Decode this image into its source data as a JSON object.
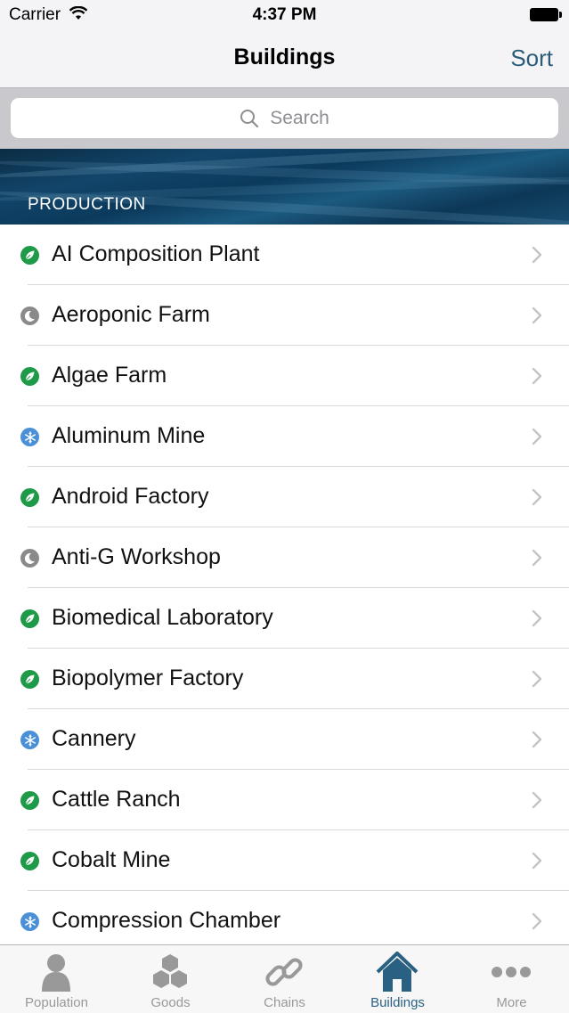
{
  "status_bar": {
    "carrier": "Carrier",
    "time": "4:37 PM"
  },
  "nav": {
    "title": "Buildings",
    "sort_label": "Sort"
  },
  "search": {
    "placeholder": "Search"
  },
  "section": {
    "title": "PRODUCTION"
  },
  "rows": [
    {
      "label": "AI Composition Plant",
      "icon": "leaf-icon",
      "color": "#1e9a48"
    },
    {
      "label": "Aeroponic Farm",
      "icon": "moon-icon",
      "color": "#8a8a8a"
    },
    {
      "label": "Algae Farm",
      "icon": "leaf-icon",
      "color": "#1e9a48"
    },
    {
      "label": "Aluminum Mine",
      "icon": "snowflake-icon",
      "color": "#4a90d6"
    },
    {
      "label": "Android Factory",
      "icon": "leaf-icon",
      "color": "#1e9a48"
    },
    {
      "label": "Anti-G Workshop",
      "icon": "moon-icon",
      "color": "#8a8a8a"
    },
    {
      "label": "Biomedical Laboratory",
      "icon": "leaf-icon",
      "color": "#1e9a48"
    },
    {
      "label": "Biopolymer Factory",
      "icon": "leaf-icon",
      "color": "#1e9a48"
    },
    {
      "label": "Cannery",
      "icon": "snowflake-icon",
      "color": "#4a90d6"
    },
    {
      "label": "Cattle Ranch",
      "icon": "leaf-icon",
      "color": "#1e9a48"
    },
    {
      "label": "Cobalt Mine",
      "icon": "leaf-icon",
      "color": "#1e9a48"
    },
    {
      "label": "Compression Chamber",
      "icon": "snowflake-icon",
      "color": "#4a90d6"
    }
  ],
  "tabs": [
    {
      "label": "Population",
      "icon": "person-icon",
      "active": false
    },
    {
      "label": "Goods",
      "icon": "hexagons-icon",
      "active": false
    },
    {
      "label": "Chains",
      "icon": "chain-link-icon",
      "active": false
    },
    {
      "label": "Buildings",
      "icon": "house-icon",
      "active": true
    },
    {
      "label": "More",
      "icon": "ellipsis-icon",
      "active": false
    }
  ],
  "colors": {
    "accent": "#2a6182",
    "green": "#1e9a48",
    "gray": "#8a8a8a",
    "blue": "#4a90d6"
  }
}
